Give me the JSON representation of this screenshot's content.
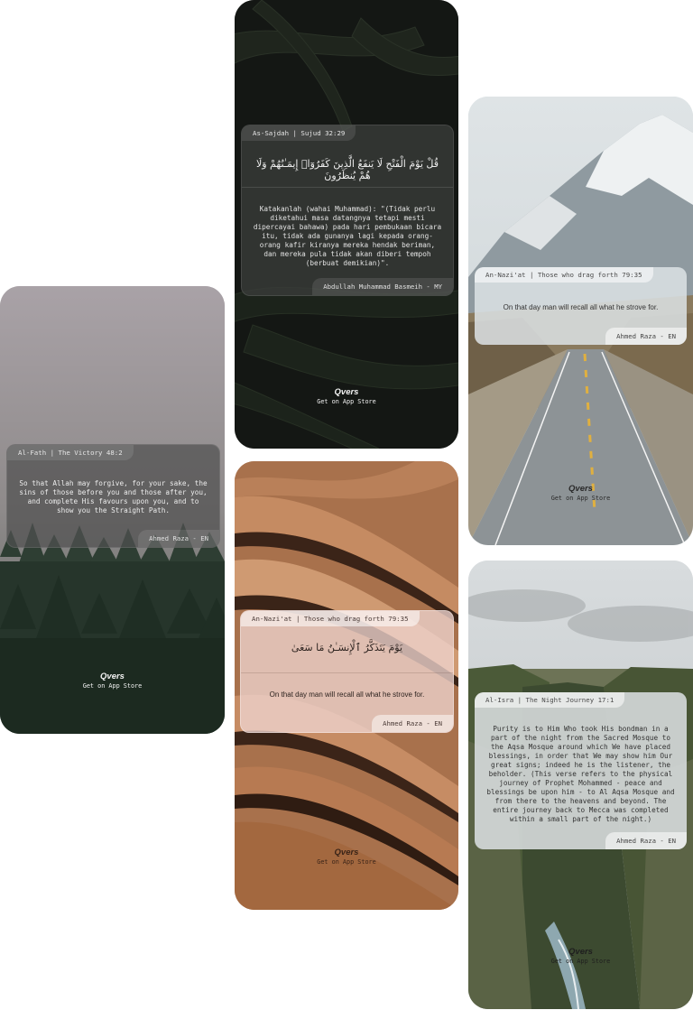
{
  "brand": {
    "name": "Qvers",
    "cta": "Get on App Store"
  },
  "cards": {
    "sajdah": {
      "tag": "As-Sajdah | Sujud 32:29",
      "arabic": "قُلْ يَوْمَ الْفَتْحِ لَا يَنفَعُ الَّذِينَ كَفَرُوٓا۟ إِيمَـٰنُهُمْ وَلَا هُمْ يُنظَرُونَ",
      "translation": "Katakanlah (wahai Muhammad): \"(Tidak perlu diketahui masa datangnya tetapi mesti dipercayai bahawa) pada hari pembukaan bicara itu, tidak ada gunanya lagi kepada orang-orang kafir kiranya mereka hendak beriman, dan mereka pula tidak akan diberi tempoh (berbuat demikian)\".",
      "author": "Abdullah Muhammad Basmeih - MY"
    },
    "nazi_road": {
      "tag": "An-Nazi'at | Those who drag forth 79:35",
      "translation": "On that day man will recall all what he strove for.",
      "author": "Ahmed Raza - EN"
    },
    "fath": {
      "tag": "Al-Fath | The Victory 48:2",
      "translation": "So that Allah may forgive, for your sake, the sins of those before you and those after you, and complete His favours upon you, and to show you the Straight Path.",
      "author": "Ahmed Raza - EN"
    },
    "nazi_wood": {
      "tag": "An-Nazi'at | Those who drag forth 79:35",
      "arabic": "يَوْمَ يَتَذَكَّرُ ٱلْإِنسَـٰنُ مَا سَعَىٰ",
      "translation": "On that day man will recall all what he strove for.",
      "author": "Ahmed Raza - EN"
    },
    "isra": {
      "tag": "Al-Isra | The Night Journey 17:1",
      "translation": "Purity is to Him Who took His bondman in a part of the night from the Sacred Mosque to the Aqsa Mosque around which We have placed blessings, in order that We may show him Our great signs; indeed he is the listener, the beholder. (This verse refers to the physical journey of Prophet Mohammed - peace and blessings be upon him - to Al Aqsa Mosque and from there to the heavens and beyond. The entire journey back to Mecca was completed within a small part of the night.)",
      "author": "Ahmed Raza - EN"
    }
  }
}
